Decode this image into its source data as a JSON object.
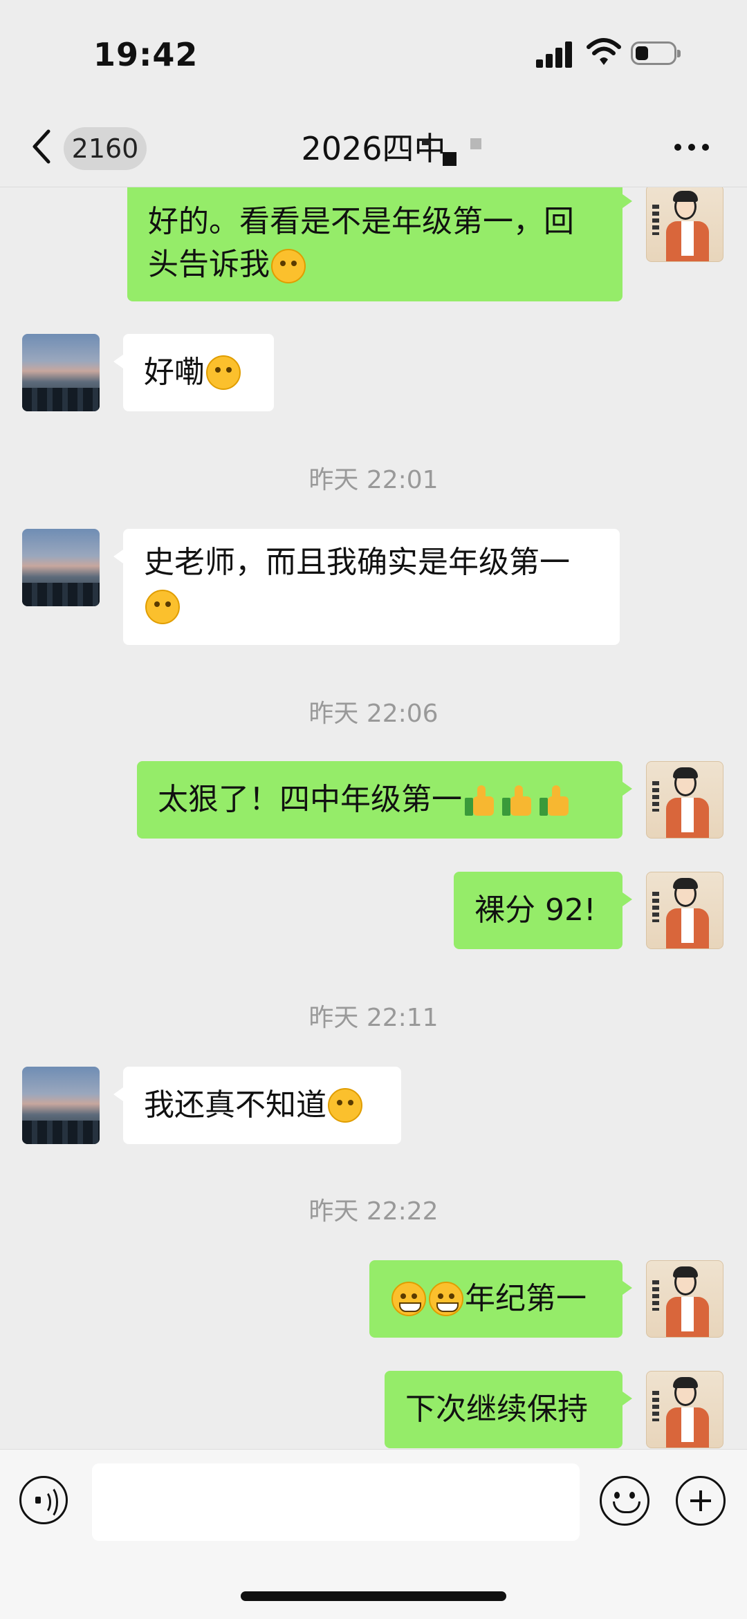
{
  "status_bar": {
    "time": "19:42",
    "icons": [
      "signal-icon",
      "wifi-icon",
      "battery-icon"
    ]
  },
  "nav": {
    "back_icon": "chevron-left-icon",
    "unread_count": "2160",
    "title": "2026四中",
    "more_icon": "more-dots-icon"
  },
  "messages": [
    {
      "side": "out",
      "text": "好的。看看是不是年级第一，回\n头告诉我",
      "emoji": [
        "smirk-emoji"
      ]
    },
    {
      "side": "in",
      "text": "好嘞",
      "emoji": [
        "ok-hand-emoji"
      ]
    },
    {
      "timestamp": "昨天 22:01"
    },
    {
      "side": "in",
      "text": "史老师，而且我确实是年级第一",
      "emoji": [
        "ok-hand-emoji"
      ]
    },
    {
      "timestamp": "昨天 22:06"
    },
    {
      "side": "out",
      "text": "太狠了！四中年级第一",
      "emoji": [
        "thumbs-up-emoji",
        "thumbs-up-emoji",
        "thumbs-up-emoji"
      ]
    },
    {
      "side": "out",
      "text": "裸分 92!"
    },
    {
      "timestamp": "昨天 22:11"
    },
    {
      "side": "in",
      "text": "我还真不知道",
      "emoji": [
        "laugh-cry-emoji"
      ]
    },
    {
      "timestamp": "昨天 22:22"
    },
    {
      "side": "out",
      "text": "年纪第一",
      "emoji": [
        "grin-emoji",
        "grin-emoji"
      ]
    },
    {
      "side": "out",
      "text": "下次继续保持"
    }
  ],
  "ts": {
    "t1": "昨天 22:01",
    "t2": "昨天 22:06",
    "t3": "昨天 22:11",
    "t4": "昨天 22:22"
  },
  "msg": {
    "m1": "好的。看看是不是年级第一，回",
    "m1b": "头告诉我",
    "m2": "好嘞",
    "m3": "史老师，而且我确实是年级第一",
    "m4": "太狠了！四中年级第一",
    "m5": "裸分 92!",
    "m6": "我还真不知道",
    "m7": "年纪第一",
    "m8": "下次继续保持"
  },
  "input_bar": {
    "voice_icon": "voice-icon",
    "input_value": "",
    "emoji_icon": "emoji-face-icon",
    "plus_icon": "plus-circle-icon"
  }
}
